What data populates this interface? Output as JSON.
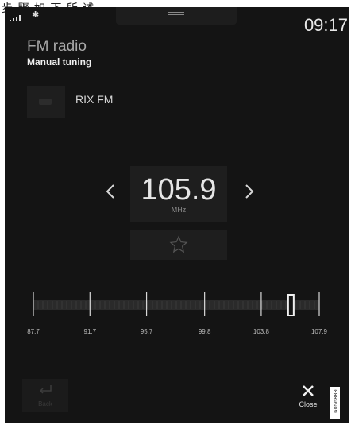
{
  "caption": "步 驟 如 下 所 述 .",
  "status": {
    "signal_icon": "signal-bars-icon",
    "bluetooth_icon": "bluetooth-icon",
    "time": "09:17"
  },
  "header": {
    "title": "FM radio",
    "subtitle": "Manual tuning"
  },
  "station": {
    "name": "RIX FM"
  },
  "tuner": {
    "frequency": "105.9",
    "unit": "MHz",
    "prev_icon": "chevron-left-icon",
    "next_icon": "chevron-right-icon",
    "favorite_icon": "star-outline-icon"
  },
  "scale": {
    "labels": [
      "87.7",
      "91.7",
      "95.7",
      "99.8",
      "103.8",
      "107.9"
    ],
    "min": 87.7,
    "max": 107.9,
    "current": 105.9
  },
  "footer": {
    "back_label": "Back",
    "close_label": "Close"
  },
  "image_ref": "G056880"
}
